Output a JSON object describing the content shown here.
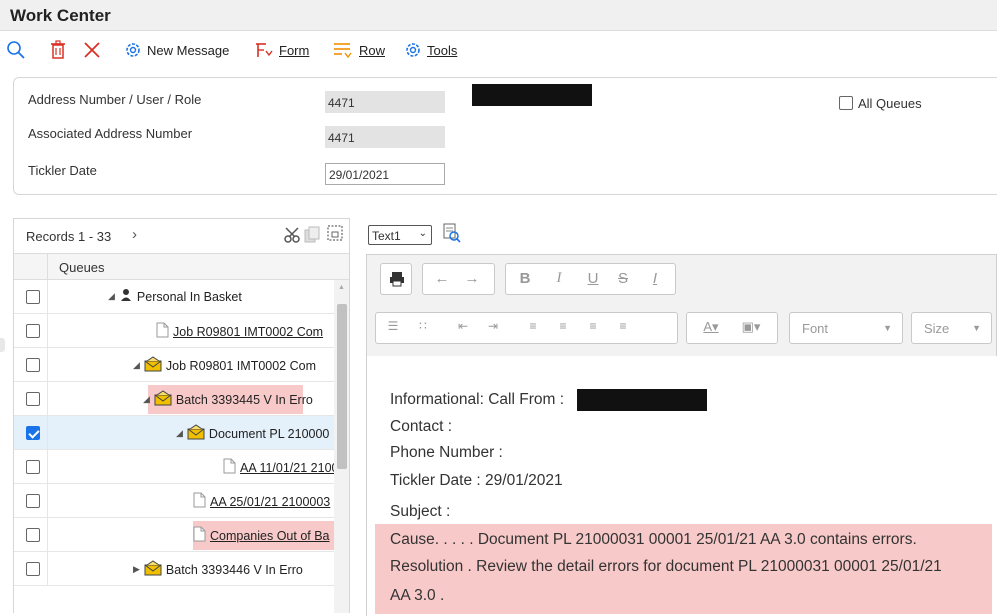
{
  "window": {
    "title": "Work Center"
  },
  "toolbar": {
    "new_message": "New Message",
    "form": "Form",
    "row": "Row",
    "tools": "Tools"
  },
  "form": {
    "address_label": "Address Number / User / Role",
    "address_value": "4471",
    "assoc_label": "Associated Address Number",
    "assoc_value": "4471",
    "tickler_label": "Tickler Date",
    "tickler_value": "29/01/2021",
    "all_queues_label": "All Queues",
    "all_queues_checked": false
  },
  "grid": {
    "records": "Records 1 - 33",
    "column_header": "Queues",
    "rows": [
      {
        "label": "Personal In Basket",
        "type": "basket",
        "link": false,
        "checked": false,
        "highlight": false
      },
      {
        "label": "Job R09801 IMT0002 Com",
        "type": "doc",
        "link": true,
        "checked": false,
        "highlight": false
      },
      {
        "label": "Job R09801 IMT0002 Com",
        "type": "envelope",
        "link": false,
        "checked": false,
        "highlight": false
      },
      {
        "label": "Batch 3393445 V In Erro",
        "type": "envelope",
        "link": false,
        "checked": false,
        "highlight": true
      },
      {
        "label": "Document PL 210000",
        "type": "envelope",
        "link": false,
        "checked": true,
        "highlight": false
      },
      {
        "label": "AA 11/01/21 2100",
        "type": "doc",
        "link": true,
        "checked": false,
        "highlight": false
      },
      {
        "label": "AA 25/01/21 2100003",
        "type": "doc",
        "link": true,
        "checked": false,
        "highlight": false
      },
      {
        "label": "Companies Out of Ba",
        "type": "doc",
        "link": true,
        "checked": false,
        "highlight": true
      },
      {
        "label": "Batch 3393446 V In Erro",
        "type": "envelope",
        "link": false,
        "checked": false,
        "highlight": false
      }
    ]
  },
  "editor": {
    "text_select": "Text1",
    "font_placeholder": "Font",
    "size_placeholder": "Size",
    "lines": {
      "informational": "Informational: Call From :",
      "contact": "Contact :",
      "phone": "Phone Number :",
      "tickler": "Tickler Date : 29/01/2021",
      "subject": "Subject :",
      "cause": "Cause. . . . . Document PL 21000031 00001 25/01/21 AA 3.0 contains errors.",
      "resolution": "Resolution . Review the detail errors for document PL 21000031 00001 25/01/21",
      "resolution2": "AA 3.0 ."
    }
  },
  "colors": {
    "accent": "#1a73e8",
    "error_highlight": "#f8c9c9",
    "delete_red": "#d93025"
  }
}
